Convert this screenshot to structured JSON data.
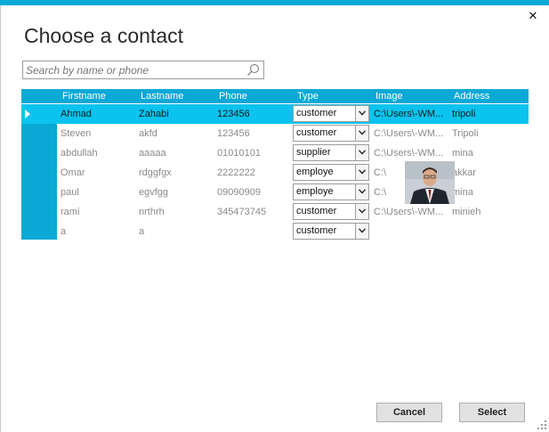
{
  "dialog": {
    "title": "Choose a contact",
    "close_glyph": "✕"
  },
  "search": {
    "placeholder": "Search by name or phone",
    "value": "",
    "icon": "search-icon"
  },
  "grid": {
    "columns": [
      "Firstname",
      "Lastname",
      "Phone",
      "Type",
      "Image",
      "Address"
    ],
    "rows": [
      {
        "firstname": "Ahmad",
        "lastname": "Zahabi",
        "phone": "123456",
        "type": "customer",
        "image": "C:\\Users\\-WM...",
        "address": "tripoli",
        "selected": true
      },
      {
        "firstname": "Steven",
        "lastname": "akfd",
        "phone": "123456",
        "type": "customer",
        "image": "C:\\Users\\-WM...",
        "address": "Tripoli"
      },
      {
        "firstname": "abdullah",
        "lastname": "aaaaa",
        "phone": "01010101",
        "type": "supplier",
        "image": "C:\\Users\\-WM...",
        "address": "mina"
      },
      {
        "firstname": "Omar",
        "lastname": "rdggfgx",
        "phone": "2222222",
        "type": "employe",
        "image": "C:\\",
        "address": "akkar"
      },
      {
        "firstname": "paul",
        "lastname": "egvfgg",
        "phone": "09090909",
        "type": "employe",
        "image": "C:\\",
        "address": "mina"
      },
      {
        "firstname": "rami",
        "lastname": "nrthrh",
        "phone": "345473745",
        "type": "customer",
        "image": "C:\\Users\\-WM...",
        "address": "minieh"
      },
      {
        "firstname": "a",
        "lastname": "a",
        "phone": "",
        "type": "customer",
        "image": "",
        "address": ""
      }
    ]
  },
  "buttons": {
    "cancel": "Cancel",
    "select": "Select"
  },
  "colors": {
    "accent": "#0aa9d6",
    "selected_row": "#0ac3ee",
    "text_muted": "#8a8a8a"
  }
}
